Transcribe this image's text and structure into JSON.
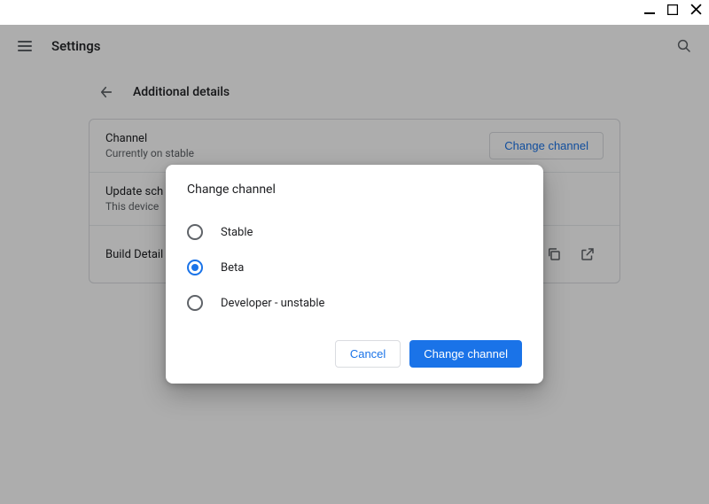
{
  "header": {
    "title": "Settings"
  },
  "section": {
    "title": "Additional details",
    "rows": {
      "channel": {
        "label": "Channel",
        "sub": "Currently on stable",
        "button": "Change channel"
      },
      "update": {
        "label": "Update sch",
        "sub": "This device"
      },
      "build": {
        "label": "Build Detail"
      }
    }
  },
  "dialog": {
    "title": "Change channel",
    "options": [
      {
        "label": "Stable",
        "selected": false
      },
      {
        "label": "Beta",
        "selected": true
      },
      {
        "label": "Developer - unstable",
        "selected": false
      }
    ],
    "cancel": "Cancel",
    "confirm": "Change channel"
  }
}
